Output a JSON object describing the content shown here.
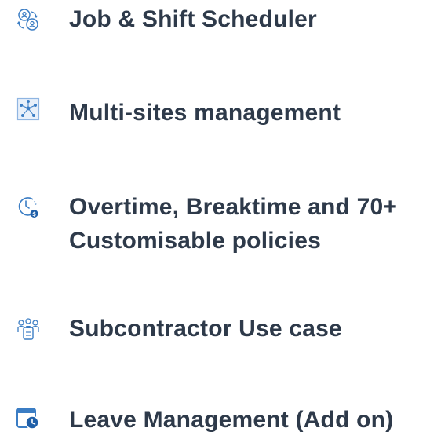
{
  "features": [
    {
      "icon": "job-shift-scheduler-icon",
      "label": "Job & Shift Scheduler"
    },
    {
      "icon": "multi-sites-management-icon",
      "label": "Multi-sites management"
    },
    {
      "icon": "overtime-policies-icon",
      "label_line1": "Overtime, Breaktime and 70+",
      "label_line2": "Customisable policies"
    },
    {
      "icon": "subcontractor-icon",
      "label": "Subcontractor Use case"
    },
    {
      "icon": "leave-management-icon",
      "label": "Leave Management (Add on)"
    }
  ],
  "colors": {
    "text": "#2e3a4a",
    "icon_blue": "#3b7dc4",
    "icon_light": "#8fb5e2"
  }
}
